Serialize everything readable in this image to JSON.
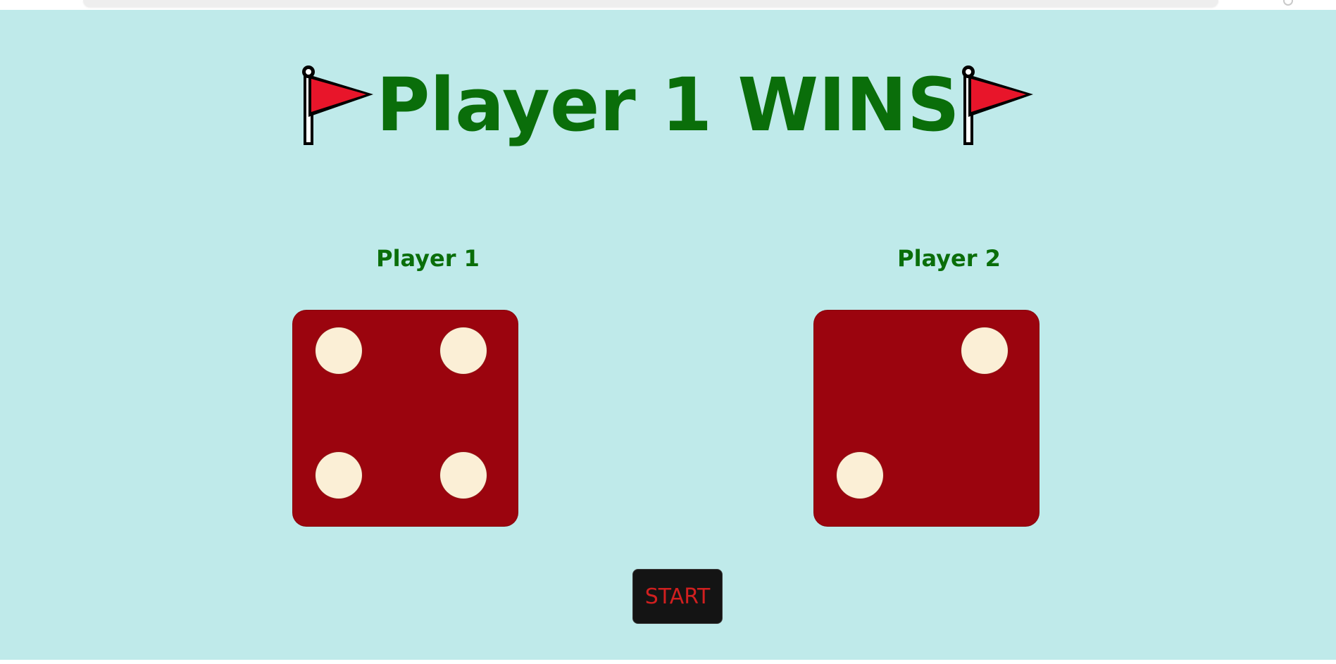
{
  "title": {
    "text": "Player 1 WINS",
    "color": "#0a6e0a",
    "left_icon": "triangular-flag-icon",
    "right_icon": "triangular-flag-icon"
  },
  "players": [
    {
      "label": "Player 1",
      "die_value": 4
    },
    {
      "label": "Player 2",
      "die_value": 2
    }
  ],
  "start_button": {
    "label": "START"
  },
  "colors": {
    "background": "#bfeaea",
    "die_face": "#9b040e",
    "pip": "#fbefd6",
    "button_bg": "#141414",
    "button_text": "#d11f1f",
    "flag_red": "#e8152a"
  }
}
